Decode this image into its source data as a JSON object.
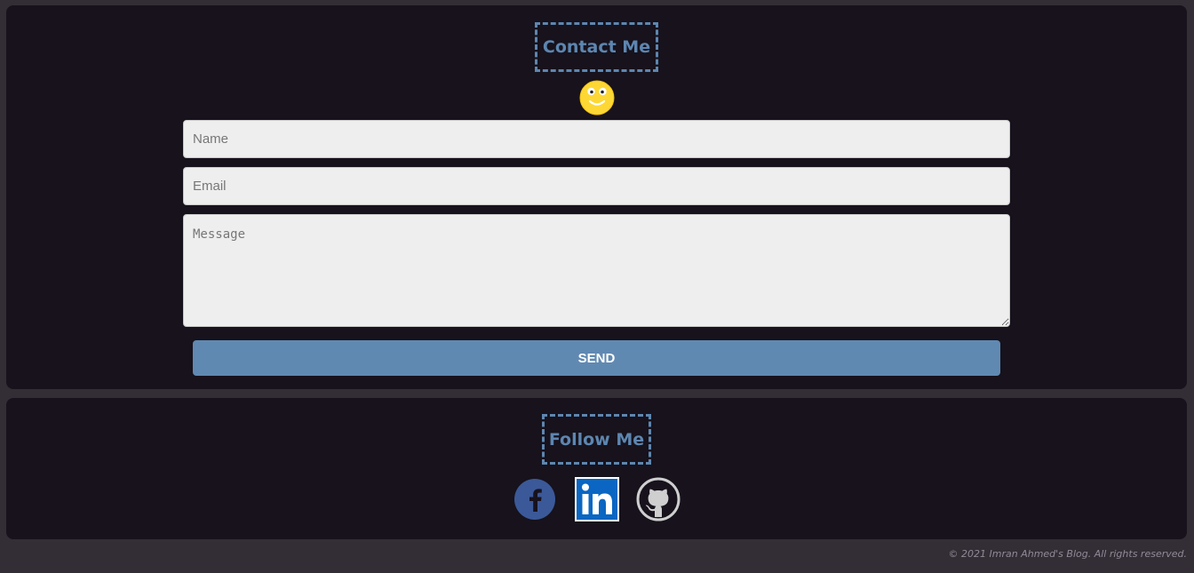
{
  "contact": {
    "title": "Contact Me",
    "name_placeholder": "Name",
    "email_placeholder": "Email",
    "message_placeholder": "Message",
    "send_label": "SEND"
  },
  "follow": {
    "title": "Follow Me",
    "links": [
      {
        "icon": "facebook-icon"
      },
      {
        "icon": "linkedin-icon"
      },
      {
        "icon": "github-icon"
      }
    ]
  },
  "footer": {
    "copyright": "© 2021 Imran Ahmed's Blog. All rights reserved."
  },
  "colors": {
    "page_background": "#332e36",
    "panel_background": "#17121c",
    "accent": "#5d86b0",
    "input_background": "#eeeeee",
    "button_background": "#6089b2",
    "facebook": "#3b5998",
    "linkedin": "#0a66c2",
    "smiley": "#fdd835"
  }
}
